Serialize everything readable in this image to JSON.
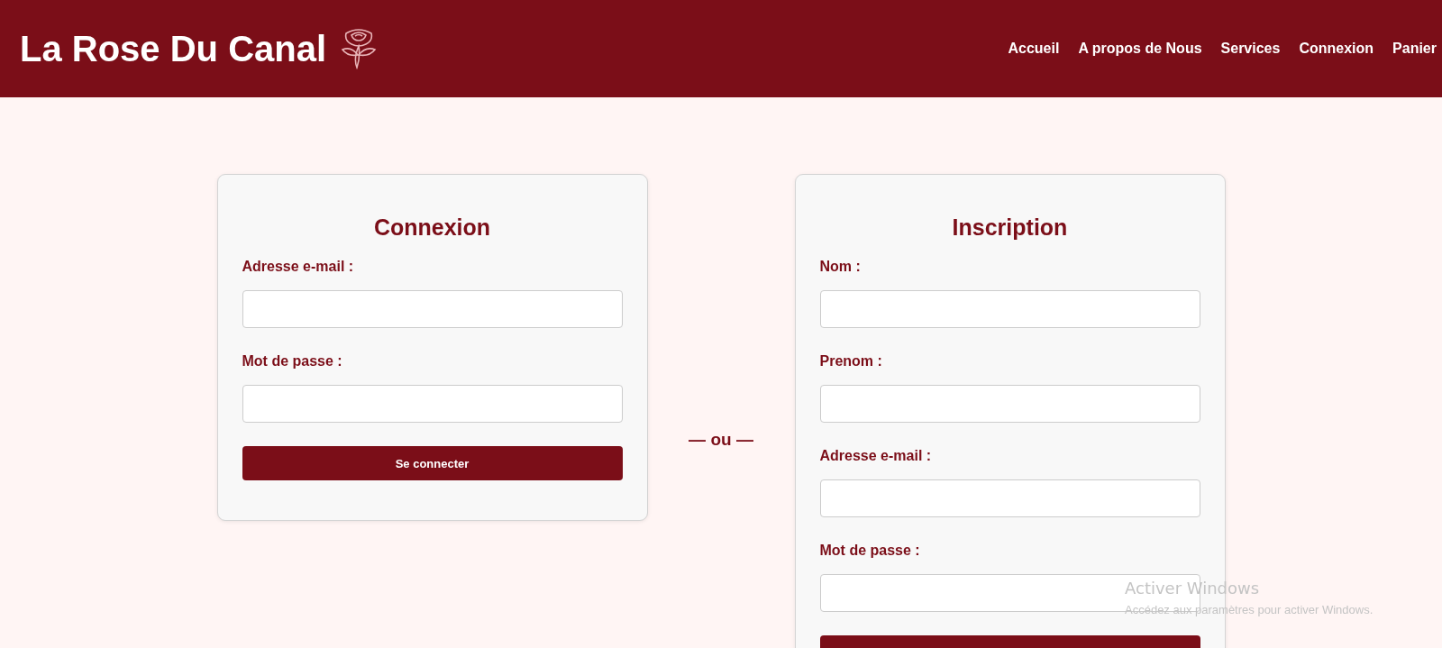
{
  "header": {
    "title": "La Rose Du Canal",
    "nav": [
      {
        "label": "Accueil"
      },
      {
        "label": "A propos de Nous"
      },
      {
        "label": "Services"
      },
      {
        "label": "Connexion"
      },
      {
        "label": "Panier"
      }
    ]
  },
  "login": {
    "title": "Connexion",
    "fields": [
      {
        "label": "Adresse e-mail :"
      },
      {
        "label": "Mot de passe :"
      }
    ],
    "button": "Se connecter"
  },
  "separator": "— ou —",
  "register": {
    "title": "Inscription",
    "fields": [
      {
        "label": "Nom :"
      },
      {
        "label": "Prenom :"
      },
      {
        "label": "Adresse e-mail :"
      },
      {
        "label": "Mot de passe :"
      }
    ]
  },
  "os_notice": {
    "title": "Activer Windows",
    "text": "Accédez aux paramètres pour activer Windows."
  }
}
